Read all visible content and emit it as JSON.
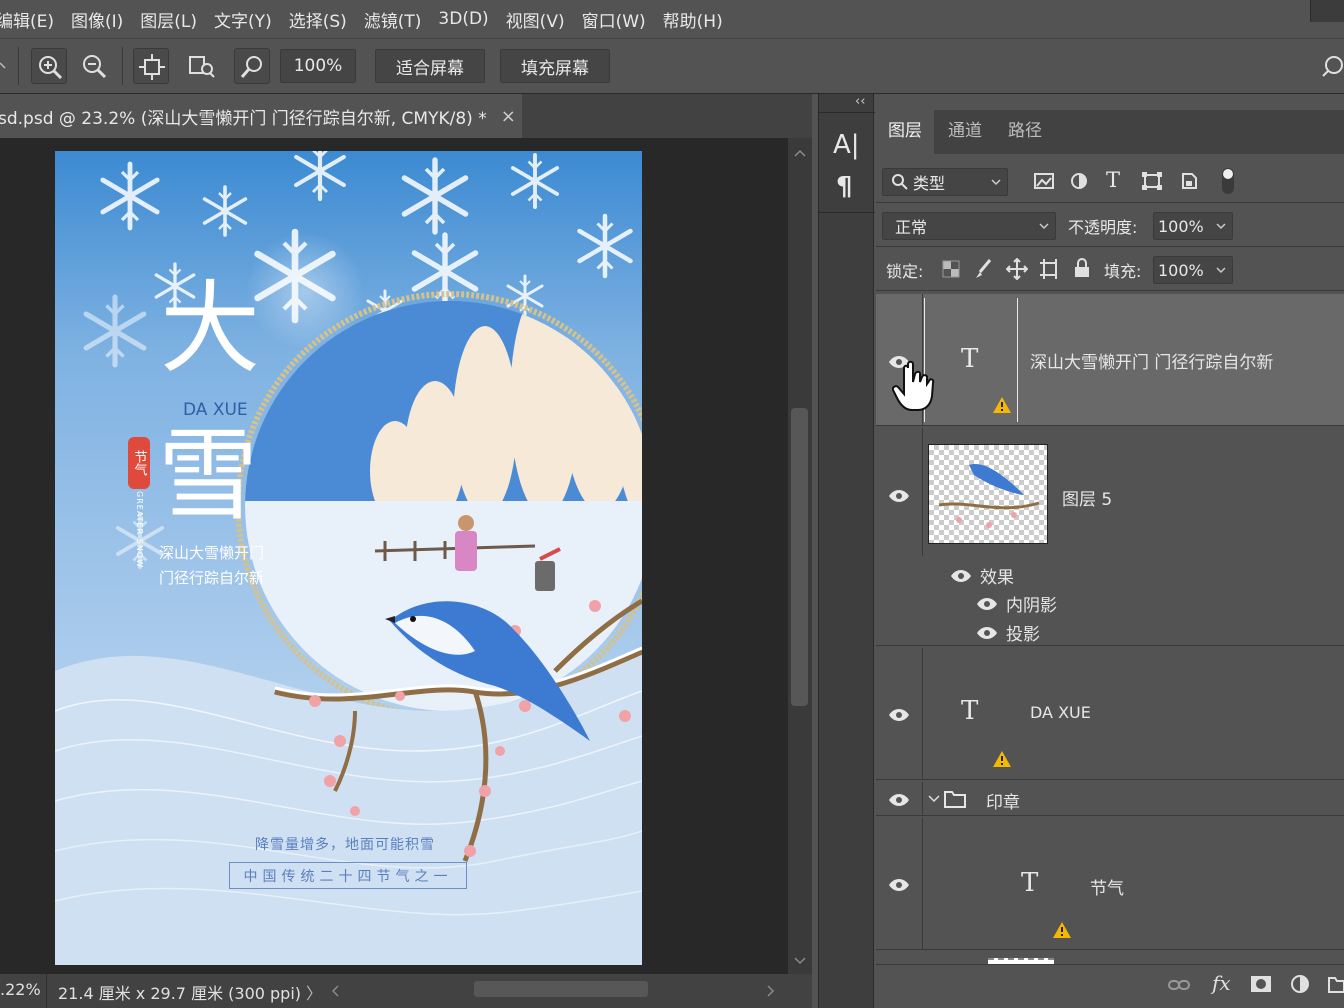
{
  "menu": [
    "编辑(E)",
    "图像(I)",
    "图层(L)",
    "文字(Y)",
    "选择(S)",
    "滤镜(T)",
    "3D(D)",
    "视图(V)",
    "窗口(W)",
    "帮助(H)"
  ],
  "options_bar": {
    "zoom_value": "100%",
    "fit_screen": "适合屏幕",
    "fill_screen": "填充屏幕"
  },
  "document": {
    "tab_title": "sd.psd @ 23.2% (深山大雪懒开门 门径行踪自尔新, CMYK/8) *",
    "close": "×",
    "zoom_status": ".22%",
    "doc_size": "21.4 厘米 x 29.7 厘米 (300 ppi)",
    "status_arrow": "〉"
  },
  "poster": {
    "title_char1": "大",
    "pinyin": "DA XUE",
    "title_char2": "雪",
    "seal_text": "节气",
    "vertical_en": "GREATER SNOW",
    "poem_line1": "深山大雪懒开门",
    "poem_line2": "门径行踪自尔新",
    "tagline": "降雪量增多，地面可能积雪",
    "box_text": "中国传统二十四节气之一"
  },
  "side_strip": {
    "collapse": "‹‹",
    "char_icon": "A|",
    "para_icon": "¶"
  },
  "layers_panel": {
    "tabs": [
      "图层",
      "通道",
      "路径"
    ],
    "active_tab": "图层",
    "filter_kind": "类型",
    "blend_mode": "正常",
    "opacity_label": "不透明度:",
    "opacity_value": "100%",
    "lock_label": "锁定:",
    "fill_label": "填充:",
    "fill_value": "100%",
    "layers": [
      {
        "name": "深山大雪懒开门 门径行踪自尔新",
        "type": "text",
        "selected": true
      },
      {
        "name": "图层 5",
        "type": "image"
      },
      {
        "name": "DA XUE",
        "type": "text"
      },
      {
        "name": "印章",
        "type": "group"
      },
      {
        "name": "节气",
        "type": "text"
      }
    ],
    "effects_label": "效果",
    "effect_items": [
      "内阴影",
      "投影"
    ]
  },
  "colors": {
    "accent": "#3d86d6",
    "panel_bg": "#535353",
    "selected_row": "#6a6a6a",
    "warning": "#f5b800"
  }
}
